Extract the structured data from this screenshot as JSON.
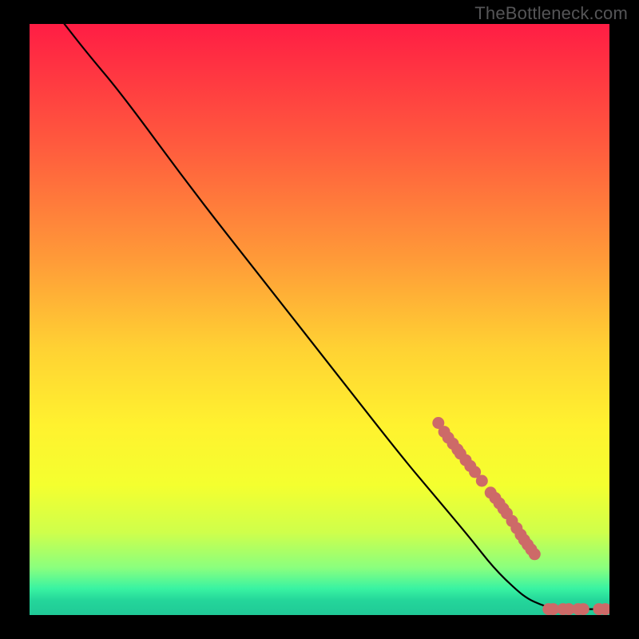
{
  "watermark": "TheBottleneck.com",
  "colors": {
    "background_black": "#000000",
    "curve": "#000000",
    "marker": "#cd6a68",
    "gradient_stops": [
      {
        "offset": 0.0,
        "color": "#ff1d44"
      },
      {
        "offset": 0.2,
        "color": "#ff593e"
      },
      {
        "offset": 0.4,
        "color": "#ff9b38"
      },
      {
        "offset": 0.55,
        "color": "#ffd233"
      },
      {
        "offset": 0.68,
        "color": "#fff22f"
      },
      {
        "offset": 0.78,
        "color": "#f4ff2f"
      },
      {
        "offset": 0.86,
        "color": "#cfff4b"
      },
      {
        "offset": 0.92,
        "color": "#8aff7e"
      },
      {
        "offset": 0.955,
        "color": "#39f3a2"
      },
      {
        "offset": 0.975,
        "color": "#24d69a"
      },
      {
        "offset": 1.0,
        "color": "#20c997"
      }
    ]
  },
  "chart_data": {
    "type": "line",
    "title": "",
    "xlabel": "",
    "ylabel": "",
    "xlim": [
      0,
      100
    ],
    "ylim": [
      0,
      100
    ],
    "curve": [
      {
        "x": 6,
        "y": 100
      },
      {
        "x": 10,
        "y": 95
      },
      {
        "x": 16,
        "y": 88
      },
      {
        "x": 28,
        "y": 72
      },
      {
        "x": 40,
        "y": 57
      },
      {
        "x": 52,
        "y": 42
      },
      {
        "x": 64,
        "y": 27
      },
      {
        "x": 70,
        "y": 20
      },
      {
        "x": 76,
        "y": 13
      },
      {
        "x": 80,
        "y": 8
      },
      {
        "x": 84,
        "y": 4.2
      },
      {
        "x": 86,
        "y": 2.7
      },
      {
        "x": 88,
        "y": 1.8
      },
      {
        "x": 90,
        "y": 1.2
      },
      {
        "x": 92,
        "y": 1.0
      },
      {
        "x": 94,
        "y": 1.0
      },
      {
        "x": 96,
        "y": 1.0
      },
      {
        "x": 98,
        "y": 1.0
      },
      {
        "x": 100,
        "y": 1.0
      }
    ],
    "markers": [
      {
        "x": 70.5,
        "y": 32.5
      },
      {
        "x": 71.5,
        "y": 31.0
      },
      {
        "x": 72.2,
        "y": 30.0
      },
      {
        "x": 73.0,
        "y": 29.0
      },
      {
        "x": 73.8,
        "y": 28.0
      },
      {
        "x": 74.3,
        "y": 27.3
      },
      {
        "x": 75.2,
        "y": 26.2
      },
      {
        "x": 76.0,
        "y": 25.2
      },
      {
        "x": 76.8,
        "y": 24.2
      },
      {
        "x": 78.0,
        "y": 22.7
      },
      {
        "x": 79.5,
        "y": 20.7
      },
      {
        "x": 80.3,
        "y": 19.8
      },
      {
        "x": 81.0,
        "y": 18.9
      },
      {
        "x": 81.7,
        "y": 18.0
      },
      {
        "x": 82.3,
        "y": 17.2
      },
      {
        "x": 83.2,
        "y": 15.9
      },
      {
        "x": 84.0,
        "y": 14.7
      },
      {
        "x": 84.7,
        "y": 13.6
      },
      {
        "x": 85.3,
        "y": 12.7
      },
      {
        "x": 85.9,
        "y": 11.9
      },
      {
        "x": 86.5,
        "y": 11.1
      },
      {
        "x": 87.1,
        "y": 10.3
      },
      {
        "x": 89.5,
        "y": 1.0
      },
      {
        "x": 90.3,
        "y": 1.0
      },
      {
        "x": 92.0,
        "y": 1.0
      },
      {
        "x": 93.0,
        "y": 1.0
      },
      {
        "x": 94.6,
        "y": 1.0
      },
      {
        "x": 95.5,
        "y": 1.0
      },
      {
        "x": 98.2,
        "y": 1.0
      },
      {
        "x": 99.3,
        "y": 1.0
      }
    ]
  }
}
